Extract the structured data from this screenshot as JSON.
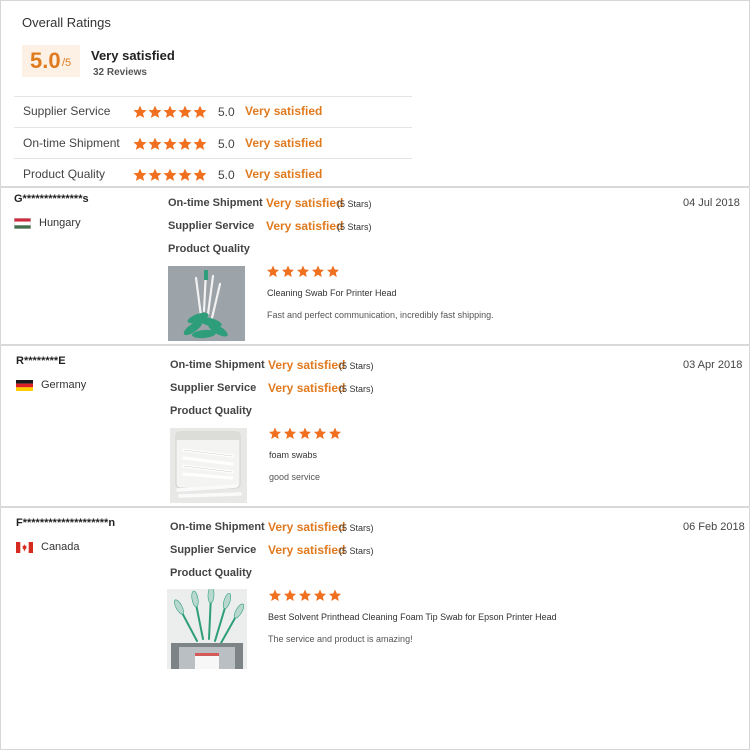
{
  "summary": {
    "title": "Overall Ratings",
    "score": "5.0",
    "score_den": "/5",
    "label": "Very satisfied",
    "count": "32 Reviews",
    "categories": [
      {
        "label": "Supplier Service",
        "value": "5.0",
        "sat": "Very satisfied",
        "stars": 5
      },
      {
        "label": "On-time Shipment",
        "value": "5.0",
        "sat": "Very satisfied",
        "stars": 5
      },
      {
        "label": "Product Quality",
        "value": "5.0",
        "sat": "Very satisfied",
        "stars": 5
      }
    ]
  },
  "colors": {
    "accent": "#e07a1f",
    "star": "#f07020"
  },
  "reviews": [
    {
      "name": "G**************s",
      "country": "Hungary",
      "flag": "hungary-flag-icon",
      "date": "04 Jul 2018",
      "ontime_label": "On-time Shipment",
      "ontime_value": "Very satisfied",
      "ontime_stars": "(5 Stars)",
      "supplier_label": "Supplier Service",
      "supplier_value": "Very satisfied",
      "supplier_stars": "(5 Stars)",
      "quality_label": "Product Quality",
      "rating": 5,
      "product": "Cleaning Swab For Printer Head",
      "comment": "Fast and perfect communication, incredibly fast shipping."
    },
    {
      "name": "R********E",
      "country": "Germany",
      "flag": "germany-flag-icon",
      "date": "03 Apr 2018",
      "ontime_label": "On-time Shipment",
      "ontime_value": "Very satisfied",
      "ontime_stars": "(5 Stars)",
      "supplier_label": "Supplier Service",
      "supplier_value": "Very satisfied",
      "supplier_stars": "(5 Stars)",
      "quality_label": "Product Quality",
      "rating": 5,
      "product": "foam swabs",
      "comment": "good service"
    },
    {
      "name": "F********************n",
      "country": "Canada",
      "flag": "canada-flag-icon",
      "date": "06 Feb 2018",
      "ontime_label": "On-time Shipment",
      "ontime_value": "Very satisfied",
      "ontime_stars": "(5 Stars)",
      "supplier_label": "Supplier Service",
      "supplier_value": "Very satisfied",
      "supplier_stars": "(5 Stars)",
      "quality_label": "Product Quality",
      "rating": 5,
      "product": "Best Solvent Printhead Cleaning Foam Tip Swab for Epson Printer Head",
      "comment": "The service and product is amazing!"
    }
  ]
}
